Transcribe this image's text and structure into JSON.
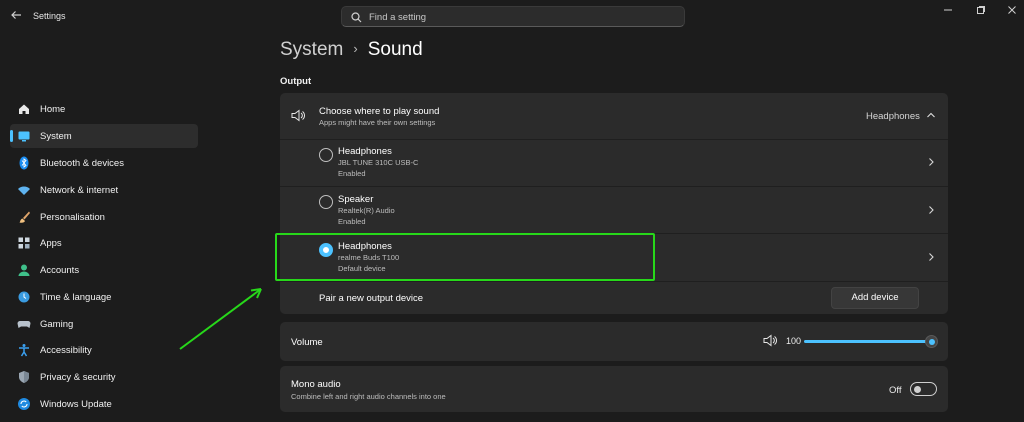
{
  "titlebar": {
    "back_icon": "arrow-left-icon",
    "app_title": "Settings",
    "search_placeholder": "Find a setting",
    "controls": [
      "minimize-icon",
      "restore-icon",
      "close-icon"
    ]
  },
  "sidebar": {
    "items": [
      {
        "label": "Home",
        "icon": "home-icon",
        "selected": false
      },
      {
        "label": "System",
        "icon": "monitor-icon",
        "selected": true
      },
      {
        "label": "Bluetooth & devices",
        "icon": "bluetooth-icon",
        "selected": false
      },
      {
        "label": "Network & internet",
        "icon": "wifi-icon",
        "selected": false
      },
      {
        "label": "Personalisation",
        "icon": "brush-icon",
        "selected": false
      },
      {
        "label": "Apps",
        "icon": "apps-grid-icon",
        "selected": false
      },
      {
        "label": "Accounts",
        "icon": "person-icon",
        "selected": false
      },
      {
        "label": "Time & language",
        "icon": "globe-clock-icon",
        "selected": false
      },
      {
        "label": "Gaming",
        "icon": "gamepad-icon",
        "selected": false
      },
      {
        "label": "Accessibility",
        "icon": "accessibility-icon",
        "selected": false
      },
      {
        "label": "Privacy & security",
        "icon": "shield-icon",
        "selected": false
      },
      {
        "label": "Windows Update",
        "icon": "update-icon",
        "selected": false
      }
    ]
  },
  "header": {
    "parent": "System",
    "separator": "›",
    "current": "Sound"
  },
  "output": {
    "section_title": "Output",
    "chooser": {
      "title": "Choose where to play sound",
      "subtitle": "Apps might have their own settings",
      "selected_value": "Headphones",
      "expanded": true
    },
    "devices": [
      {
        "name": "Headphones",
        "model": "JBL TUNE 310C USB-C",
        "status": "Enabled",
        "selected": false
      },
      {
        "name": "Speaker",
        "model": "Realtek(R) Audio",
        "status": "Enabled",
        "selected": false
      },
      {
        "name": "Headphones",
        "model": "realme Buds T100",
        "status": "Default device",
        "selected": true
      }
    ],
    "pair": {
      "label": "Pair a new output device",
      "button": "Add device"
    },
    "volume": {
      "label": "Volume",
      "value": "100",
      "fraction": 1.0
    },
    "mono_audio": {
      "title": "Mono audio",
      "subtitle": "Combine left and right audio channels into one",
      "state_label": "Off",
      "on": false
    }
  },
  "colors": {
    "accent": "#4cc2ff",
    "highlight_box": "#27d81a",
    "annotation_arrow": "#27d81a",
    "background": "#1c1c1c",
    "card": "#2b2b2b"
  }
}
